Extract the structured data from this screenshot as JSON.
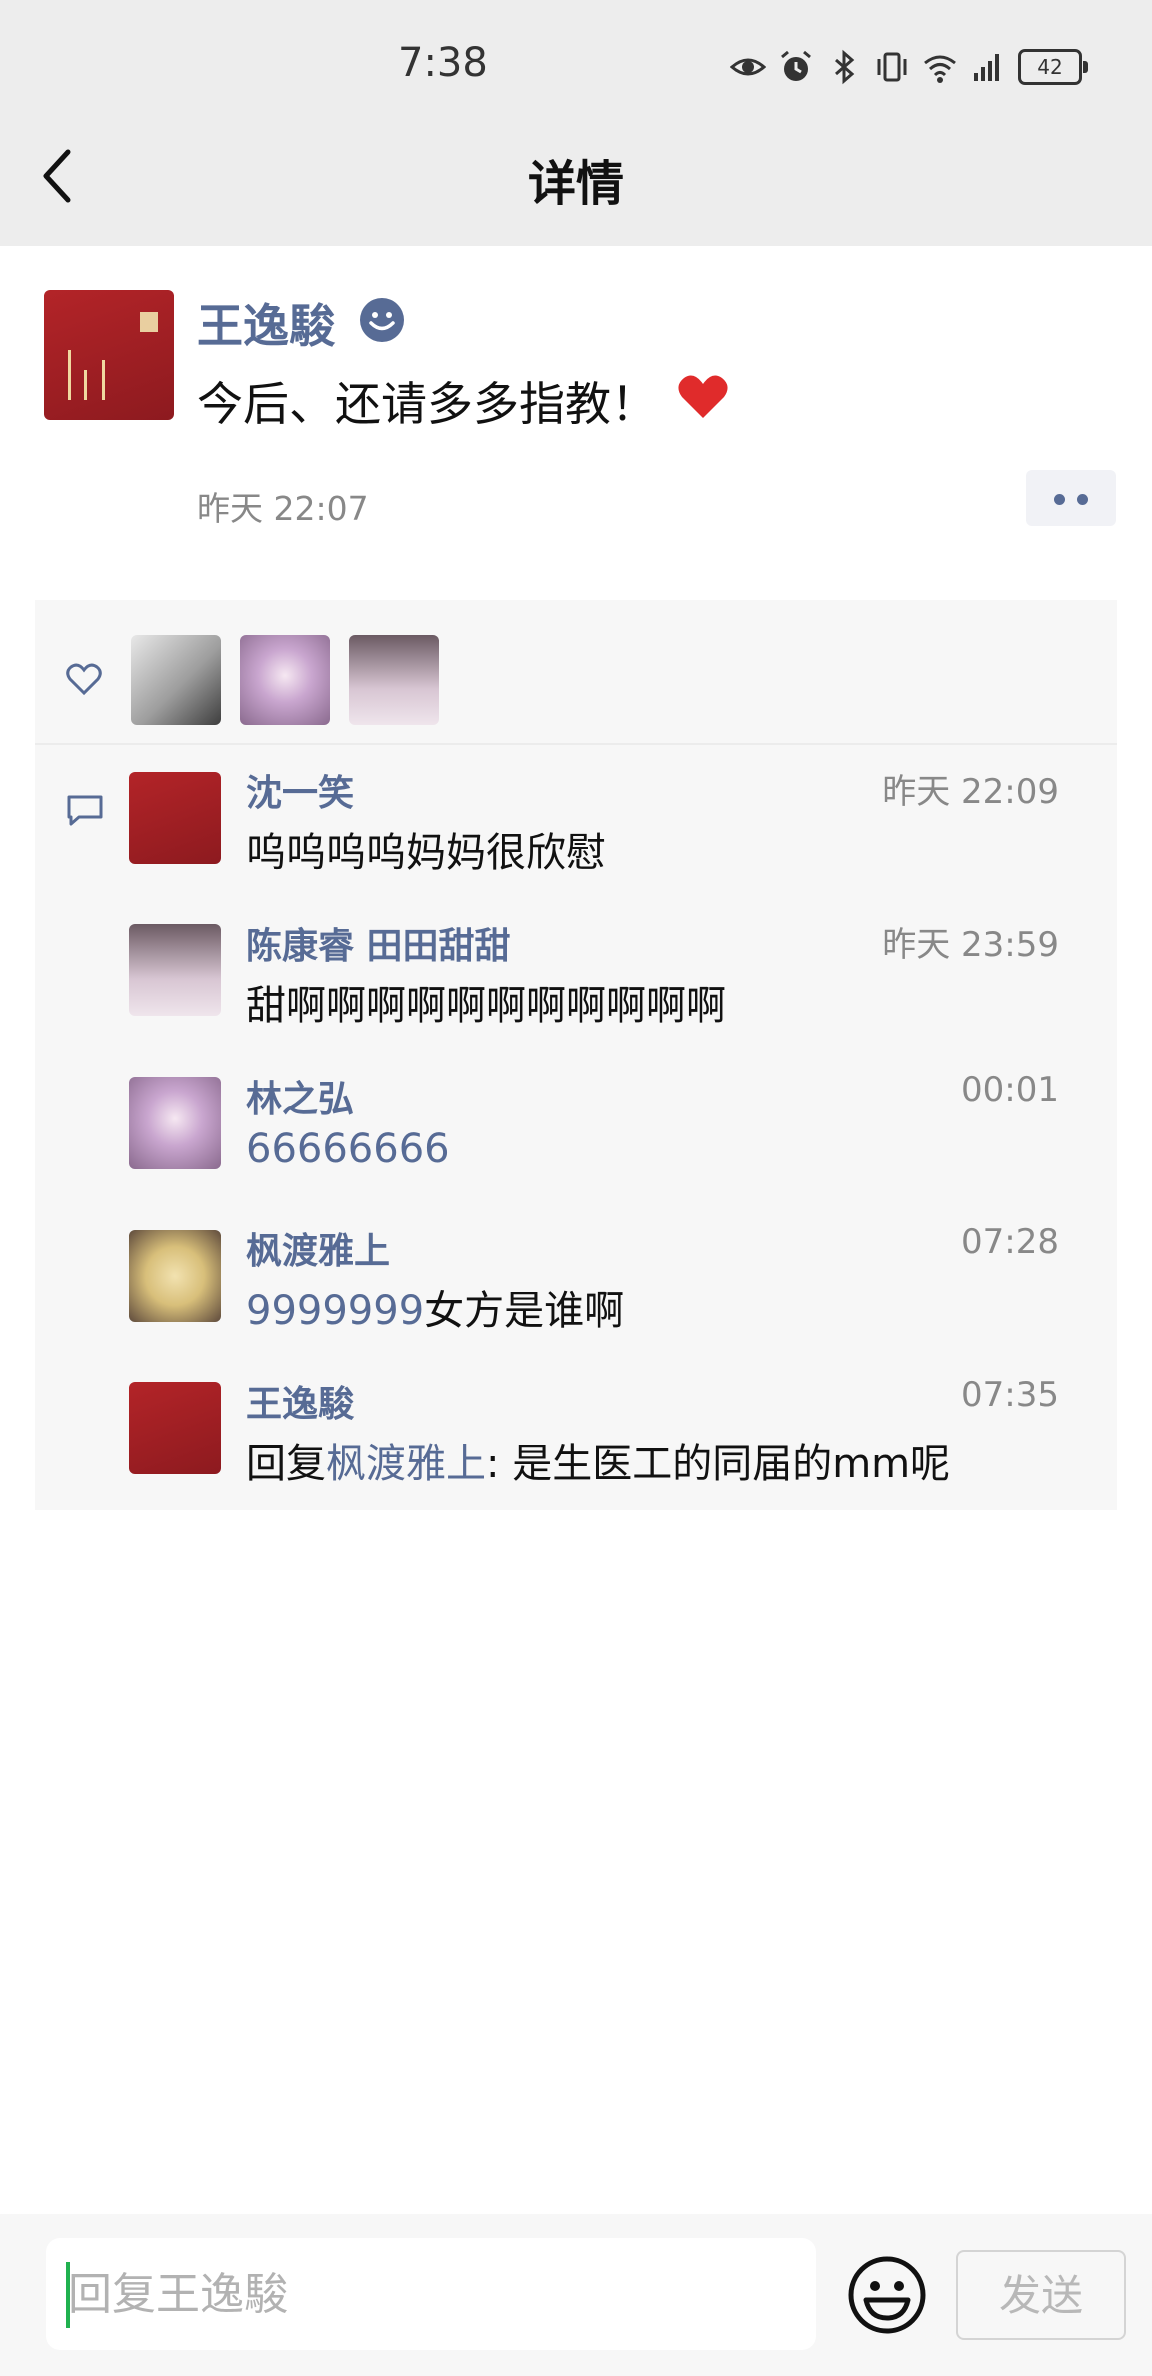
{
  "status_bar": {
    "time": "7:38",
    "battery": "42"
  },
  "header": {
    "title": "详情"
  },
  "post": {
    "author": "王逸駿",
    "text": "今后、还请多多指教！",
    "time": "昨天 22:07"
  },
  "comments": [
    {
      "name": "沈一笑",
      "time": "昨天 22:09",
      "text": "呜呜呜呜妈妈很欣慰"
    },
    {
      "name": "陈康睿 田田甜甜",
      "time": "昨天 23:59",
      "text": "甜啊啊啊啊啊啊啊啊啊啊啊"
    },
    {
      "name": "林之弘",
      "time": "00:01",
      "text_link": "66666666"
    },
    {
      "name": "枫渡雅上",
      "time": "07:28",
      "text_link": "9999999",
      "text": "女方是谁啊"
    },
    {
      "name": "王逸駿",
      "time": "07:35",
      "reply_prefix": "回复",
      "reply_to": "枫渡雅上",
      "text": ": 是生医工的同届的mm呢"
    }
  ],
  "reply_bar": {
    "placeholder": "回复王逸駿",
    "send_label": "发送"
  },
  "colors": {
    "link": "#576b95",
    "header_bg": "#ededed",
    "panel_bg": "#f7f7f7"
  }
}
